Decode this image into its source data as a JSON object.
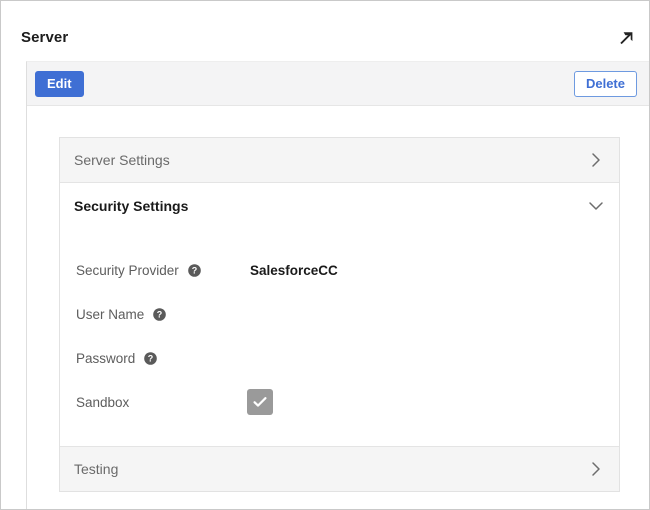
{
  "header": {
    "title": "Server",
    "expand_icon": "open-in-new-arrow-icon"
  },
  "toolbar": {
    "edit_label": "Edit",
    "delete_label": "Delete"
  },
  "accordion": {
    "sections": [
      {
        "label": "Server Settings",
        "state": "collapsed",
        "chevron": "chevron-right-icon"
      },
      {
        "label": "Security Settings",
        "state": "expanded",
        "chevron": "chevron-down-icon"
      },
      {
        "label": "Testing",
        "state": "collapsed",
        "chevron": "chevron-right-icon"
      }
    ]
  },
  "security_settings": {
    "fields": [
      {
        "label": "Security Provider",
        "has_help": true,
        "help_icon": "help-circle-icon",
        "value": "SalesforceCC",
        "type": "text"
      },
      {
        "label": "User Name",
        "has_help": true,
        "help_icon": "help-circle-icon",
        "value": "",
        "type": "text"
      },
      {
        "label": "Password",
        "has_help": true,
        "help_icon": "help-circle-icon",
        "value": "",
        "type": "text"
      },
      {
        "label": "Sandbox",
        "has_help": false,
        "value": "checked",
        "type": "checkbox",
        "checkbox_checked": true,
        "checkbox_disabled": true
      }
    ]
  },
  "colors": {
    "primary_blue": "#3f6fd4",
    "toolbar_bg": "#f4f4f5",
    "section_collapsed_bg": "#f5f5f5",
    "checkbox_disabled": "#9a9a9a",
    "label_gray": "#5d5d5d",
    "border": "#e2e2e2"
  }
}
